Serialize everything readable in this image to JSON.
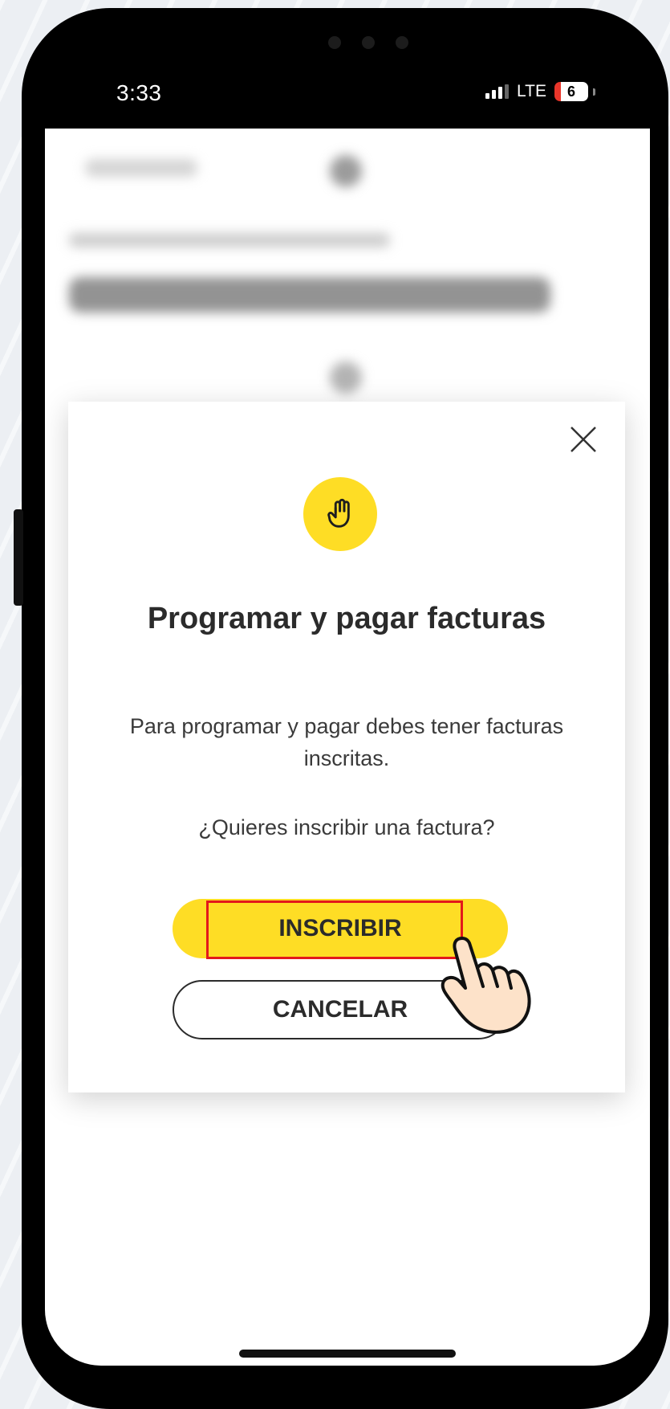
{
  "status_bar": {
    "time": "3:33",
    "network": "LTE",
    "battery": "6"
  },
  "modal": {
    "title": "Programar y pagar facturas",
    "message": "Para programar y pagar debes tener facturas inscritas.",
    "question": "¿Quieres inscribir una factura?",
    "primary_button": "INSCRIBIR",
    "secondary_button": "CANCELAR",
    "icon": "raised-hand-icon",
    "close_icon": "close-icon",
    "accent_color": "#fedd25"
  },
  "annotation": {
    "highlight_color": "#e3191b",
    "pointer_icon": "pointing-hand-icon"
  }
}
